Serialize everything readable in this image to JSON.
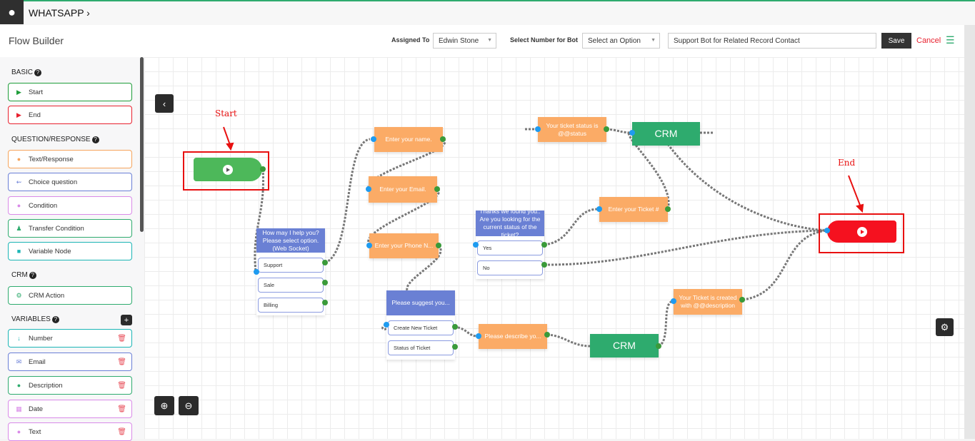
{
  "app": {
    "title": "WHATSAPP",
    "chevron": "›",
    "page_title": "Flow Builder"
  },
  "header": {
    "assigned_label": "Assigned To",
    "assigned_value": "Edwin Stone",
    "number_label": "Select Number for Bot",
    "number_value": "Select an Option",
    "bot_name": "Support Bot for Related Record Contact",
    "save": "Save",
    "cancel": "Cancel"
  },
  "sidebar": {
    "sections": {
      "basic": "BASIC",
      "question": "QUESTION/RESPONSE",
      "crm": "CRM",
      "variables": "VARIABLES"
    },
    "items": [
      {
        "label": "Start",
        "color": "#1f9d3a",
        "icon": "play-circle-icon"
      },
      {
        "label": "End",
        "color": "#e8202e",
        "icon": "play-circle-icon"
      },
      {
        "label": "Text/Response",
        "color": "#f6a45c",
        "icon": "user-icon"
      },
      {
        "label": "Choice question",
        "color": "#6a7fd6",
        "icon": "usb-icon"
      },
      {
        "label": "Condition",
        "color": "#d98ae8",
        "icon": "question-icon"
      },
      {
        "label": "Transfer Condition",
        "color": "#2eab6e",
        "icon": "users-icon"
      },
      {
        "label": "Variable Node",
        "color": "#1bb5b5",
        "icon": "square-icon"
      },
      {
        "label": "CRM Action",
        "color": "#2eab6e",
        "icon": "cogs-icon"
      }
    ],
    "variables": [
      {
        "label": "Number",
        "color": "#1bb5b5",
        "icon": "sort-numeric-icon"
      },
      {
        "label": "Email",
        "color": "#6a7fd6",
        "icon": "envelope-icon"
      },
      {
        "label": "Description",
        "color": "#2eab6e",
        "icon": "circle-icon"
      },
      {
        "label": "Date",
        "color": "#d98ae8",
        "icon": "calendar-icon"
      },
      {
        "label": "Text",
        "color": "#d98ae8",
        "icon": "circle-icon"
      }
    ]
  },
  "canvas": {
    "annotations": {
      "start": "Start",
      "end": "End"
    },
    "nodes": {
      "name": "Enter your name.",
      "email": "Enter your Email.",
      "phone": "Enter your Phone N...",
      "help": {
        "header": "How may I help you? Please select option. (Web Socket)",
        "options": [
          "Support",
          "Sale",
          "Billing"
        ]
      },
      "suggest": {
        "header": "Please suggest you...",
        "options": [
          "Create New Ticket",
          "Status of Ticket"
        ]
      },
      "thanks": {
        "header": "Thanks we found you.. Are you looking for the current status of the ticket?",
        "options": [
          "Yes",
          "No"
        ]
      },
      "status": "Your ticket status is @@status",
      "crm_top": "CRM",
      "ticket_no": "Enter your Ticket #",
      "describe": "Please describe yo...",
      "crm_bottom": "CRM",
      "created": "Your Ticket is created with @@description"
    }
  }
}
